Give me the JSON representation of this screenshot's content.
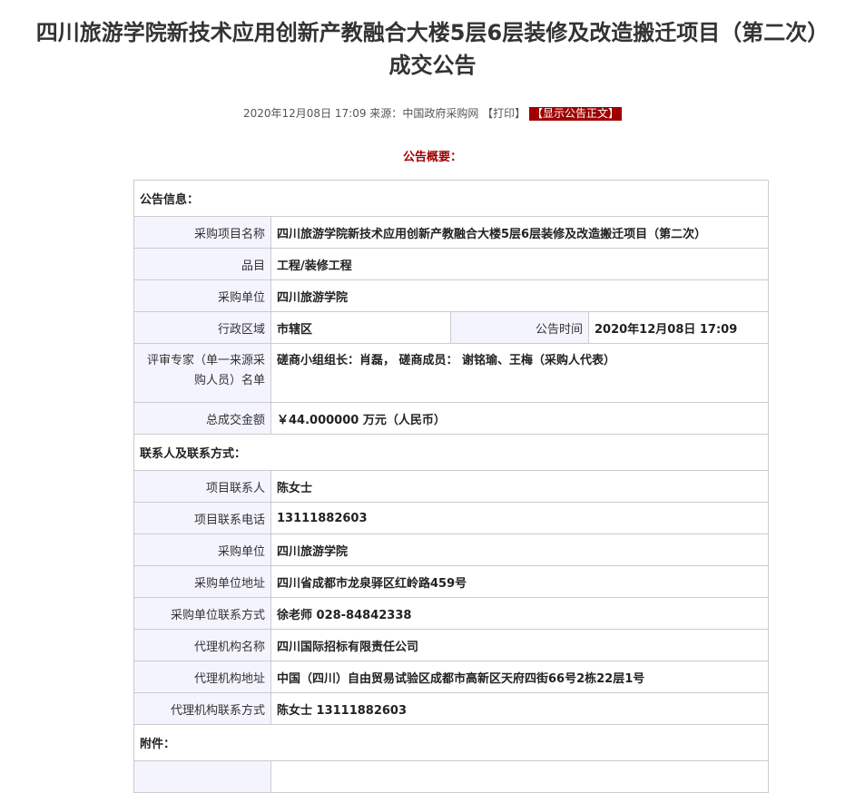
{
  "title": {
    "line1": "四川旅游学院新技术应用创新产教融合大楼5层6层装修及改造搬迁项目（第二次）",
    "line2": "成交公告"
  },
  "meta": {
    "date": "2020年12月08日 17:09",
    "source_label": "来源：",
    "source": "中国政府采购网",
    "print": "【打印】",
    "show_body": "【显示公告正文】"
  },
  "summary_heading": "公告概要：",
  "sections": {
    "announcement": "公告信息：",
    "contacts": "联系人及联系方式：",
    "attachments": "附件："
  },
  "announcement": {
    "project_name_label": "采购项目名称",
    "project_name": "四川旅游学院新技术应用创新产教融合大楼5层6层装修及改造搬迁项目（第二次）",
    "category_label": "品目",
    "category": "工程/装修工程",
    "purchaser_label": "采购单位",
    "purchaser": "四川旅游学院",
    "region_label": "行政区域",
    "region": "市辖区",
    "time_label": "公告时间",
    "time": "2020年12月08日 17:09",
    "experts_label": "评审专家（单一来源采购人员）名单",
    "experts": "磋商小组组长：肖磊， 磋商成员： 谢铭瑜、王梅（采购人代表）",
    "amount_label": "总成交金额",
    "amount": "￥44.000000 万元（人民币）"
  },
  "contacts": {
    "project_contact_label": "项目联系人",
    "project_contact": "陈女士",
    "project_phone_label": "项目联系电话",
    "project_phone": "13111882603",
    "purchaser_label": "采购单位",
    "purchaser": "四川旅游学院",
    "purchaser_address_label": "采购单位地址",
    "purchaser_address": "四川省成都市龙泉驿区红岭路459号",
    "purchaser_contact_label": "采购单位联系方式",
    "purchaser_contact": "徐老师 028-84842338",
    "agency_name_label": "代理机构名称",
    "agency_name": "四川国际招标有限责任公司",
    "agency_address_label": "代理机构地址",
    "agency_address": "中国（四川）自由贸易试验区成都市高新区天府四街66号2栋22层1号",
    "agency_contact_label": "代理机构联系方式",
    "agency_contact": "陈女士 13111882603"
  },
  "colors": {
    "accent_red": "#a00000",
    "label_bg": "#f4f4ff",
    "border": "#cccccc"
  }
}
